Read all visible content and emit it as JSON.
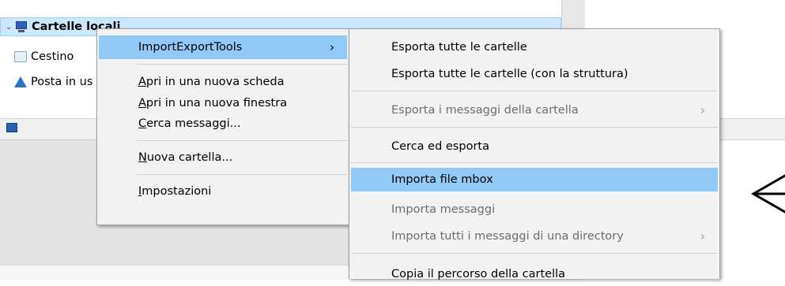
{
  "folder_tree": {
    "root": {
      "label": "Cartelle locali",
      "expanded": true
    },
    "children": [
      {
        "label": "Cestino",
        "icon": "trash-icon"
      },
      {
        "label": "Posta in uscita",
        "icon": "outbox-icon"
      }
    ]
  },
  "context_menu": {
    "items": [
      {
        "label": "ImportExportTools",
        "has_submenu": true,
        "highlighted": true
      },
      {
        "label": "Apri in una nuova scheda",
        "accesskey": "A"
      },
      {
        "label": "Apri in una nuova finestra",
        "accesskey": "A"
      },
      {
        "label": "Cerca messaggi...",
        "accesskey": "C"
      },
      {
        "label": "Nuova cartella...",
        "accesskey": "N"
      },
      {
        "label": "Impostazioni",
        "accesskey": "I"
      }
    ],
    "submenu_arrow": "›"
  },
  "submenu": {
    "items": [
      {
        "label": "Esporta tutte le cartelle"
      },
      {
        "label": "Esporta tutte le cartelle (con la struttura)"
      },
      {
        "label": "Esporta i messaggi della cartella",
        "disabled": true,
        "has_submenu": true
      },
      {
        "label": "Cerca ed esporta"
      },
      {
        "label": "Importa file mbox",
        "highlighted": true
      },
      {
        "label": "Importa messaggi",
        "disabled": true
      },
      {
        "label": "Importa tutti i messaggi di una directory",
        "disabled": true,
        "has_submenu": true
      },
      {
        "label": "Copia il percorso della cartella"
      }
    ]
  },
  "colors": {
    "menu_background": "#f2f2f2",
    "highlight": "#91c9f7",
    "selected_row": "#cce8ff",
    "disabled_text": "#6d6d6d"
  }
}
